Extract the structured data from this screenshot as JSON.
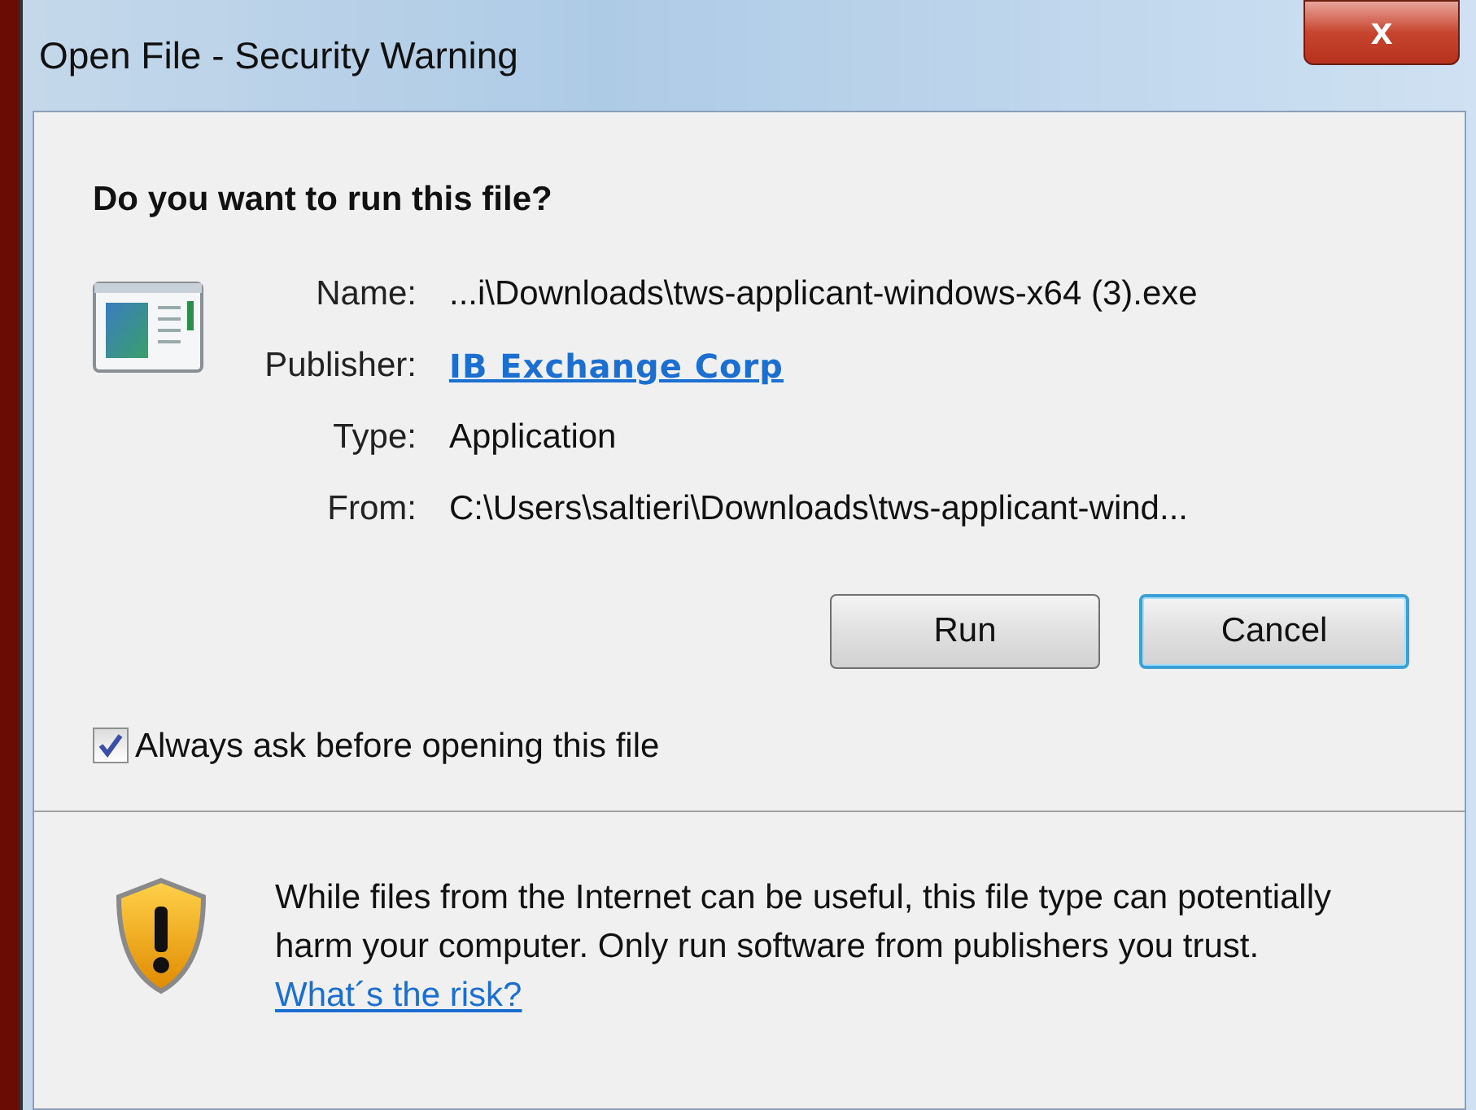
{
  "window": {
    "title": "Open File - Security Warning",
    "close": "x"
  },
  "question": "Do you want to run this file?",
  "fields": [
    {
      "label": "Name:",
      "value": "...i\\Downloads\\tws-applicant-windows-x64 (3).exe",
      "kind": "text"
    },
    {
      "label": "Publisher:",
      "value": "IB Exchange Corp",
      "kind": "link"
    },
    {
      "label": "Type:",
      "value": "Application",
      "kind": "text"
    },
    {
      "label": "From:",
      "value": "C:\\Users\\saltieri\\Downloads\\tws-applicant-wind...",
      "kind": "text"
    }
  ],
  "buttons": [
    {
      "label": "Run",
      "default": false
    },
    {
      "label": "Cancel",
      "default": true
    }
  ],
  "always_ask": {
    "label": "Always ask before opening this file",
    "checked": true
  },
  "warning": {
    "text": "While files from the Internet can be useful, this file type can potentially harm your computer. Only run software from publishers you trust.",
    "link": "What´s the risk?"
  }
}
